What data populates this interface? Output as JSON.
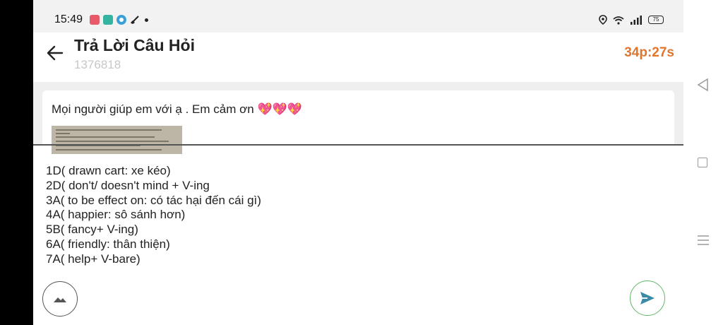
{
  "status_bar": {
    "time": "15:49",
    "notification_icons": [
      "app-icon-red",
      "app-icon-teal",
      "app-icon-blue",
      "broom-icon"
    ],
    "battery": "75"
  },
  "header": {
    "title": "Trả Lời Câu Hỏi",
    "question_id": "1376818",
    "timer": "34p:27s"
  },
  "question": {
    "text": "Mọi người giúp em với ạ . Em cảm ơn",
    "emoji": "💖💖💖"
  },
  "answer": {
    "lines": [
      "1D( drawn cart: xe kéo)",
      "2D( don't/ doesn't mind + V-ing",
      "3A( to be effect on: có tác hại đến cái gì)",
      "4A( happier: sô sánh hơn)",
      "5B( fancy+ V-ing)",
      "6A( friendly: thân thiện)",
      "7A( help+ V-bare)"
    ]
  },
  "colors": {
    "timer": "#e0762e",
    "send_border": "#63b86a",
    "send_icon": "#3a8aa8",
    "header_bg": "#ffffff",
    "question_bg": "#efefef"
  }
}
